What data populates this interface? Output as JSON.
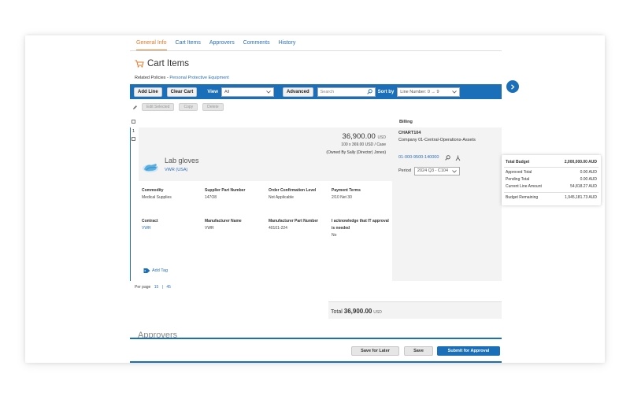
{
  "tabs": [
    "General Info",
    "Cart Items",
    "Approvers",
    "Comments",
    "History"
  ],
  "page_title": "Cart Items",
  "related": {
    "label": "Related Policies -",
    "link": "Personal Protective Equipment"
  },
  "toolbar": {
    "add_line": "Add Line",
    "clear_cart": "Clear Cart",
    "view_label": "View",
    "view_value": "All",
    "advanced": "Advanced",
    "search_placeholder": "Search",
    "sort_label": "Sort by",
    "sort_value": "Line Number: 0 → 9"
  },
  "sub_toolbar": {
    "edit_selected": "Edit Selected",
    "copy": "Copy",
    "delete": "Delete"
  },
  "billing_header": "Billing",
  "line": {
    "number": "1",
    "price": "36,900.00",
    "currency": "USD",
    "unit_price": "100 x 369.00 USD / Case",
    "owned_by": "(Owned By Sally (Director) Jones)",
    "name": "Lab gloves",
    "supplier": "VWR (USA)",
    "fields": [
      {
        "label": "Commodity",
        "value": "Medical Supplies"
      },
      {
        "label": "Supplier Part Number",
        "value": "147O8"
      },
      {
        "label": "Order Confirmation Level",
        "value": "Not Applicable"
      },
      {
        "label": "Payment Terms",
        "value": "2/10 Net 30"
      },
      {
        "label": "Contract",
        "value": "VWR"
      },
      {
        "label": "Manufacturer Name",
        "value": "VWR"
      },
      {
        "label": "Manufacturer Part Number",
        "value": "40101-224"
      },
      {
        "label": "I acknowledge that IT approval is needed",
        "value": "No"
      }
    ],
    "add_tag": "Add Tag"
  },
  "billing": {
    "account_code": "CHART104",
    "company": "Company 01-Central-Operations-Assets",
    "account_link": "01-000-9500-140000",
    "period_label": "Period",
    "period_value": "2024 Q3 - C104"
  },
  "per_page": {
    "label": "Per page",
    "opt1": "15",
    "sep": "|",
    "opt2": "45"
  },
  "total": {
    "label": "Total",
    "amount": "36,900.00",
    "currency": "USD"
  },
  "approvers_heading": "Approvers",
  "footer": {
    "save_later": "Save for Later",
    "save": "Save",
    "submit": "Submit for Approval"
  },
  "budget": {
    "total_label": "Total Budget",
    "total_value": "2,000,000.00 AUD",
    "approved_label": "Approved Total",
    "approved_value": "0.00 AUD",
    "pending_label": "Pending Total",
    "pending_value": "0.00 AUD",
    "current_label": "Current Line Amount",
    "current_value": "54,818.27 AUD",
    "remaining_label": "Budget Remaining",
    "remaining_value": "1,945,181.73 AUD"
  },
  "colors": {
    "primary": "#1a6fb8",
    "active_tab": "#e07b2b",
    "link": "#2a6ebb"
  }
}
